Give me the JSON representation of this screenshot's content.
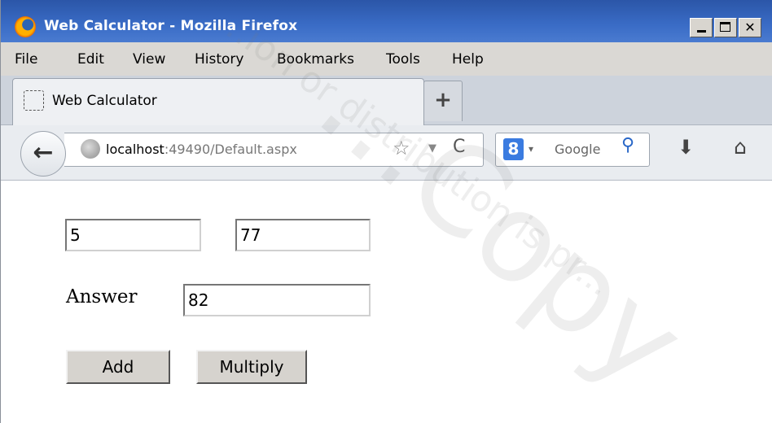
{
  "window": {
    "title": "Web Calculator - Mozilla Firefox",
    "controls": {
      "minimize": "_",
      "maximize": "□",
      "close": "✕"
    }
  },
  "menu": [
    "File",
    "Edit",
    "View",
    "History",
    "Bookmarks",
    "Tools",
    "Help"
  ],
  "tab": {
    "title": "Web Calculator",
    "new_tab": "+"
  },
  "nav": {
    "back": "←",
    "url_host": "localhost",
    "url_rest": ":49490/Default.aspx",
    "star": "☆",
    "dropdown": "▼",
    "reload": "C",
    "search_engine": "8",
    "search_dropdown": "▾",
    "search_placeholder": "Google",
    "search_button": "⚲",
    "download": "⬇",
    "home": "⌂"
  },
  "form": {
    "input1": "5",
    "input2": "77",
    "answer_label": "Answer",
    "answer": "82",
    "add_label": "Add",
    "multiply_label": "Multiply"
  },
  "watermark": {
    "line1": "...ion or distribution is pr...",
    "line2": "...Copy"
  }
}
